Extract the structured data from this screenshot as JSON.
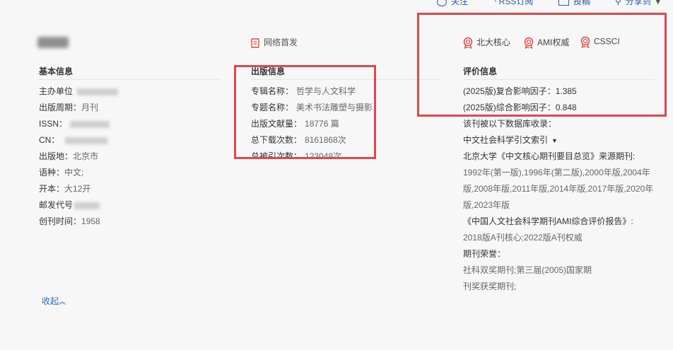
{
  "topbar": {
    "follow": "关注",
    "rss": "RSS订阅",
    "submit": "投稿",
    "share": "分享到"
  },
  "online_first": "网络首发",
  "badges": [
    "北大核心",
    "AMI权威",
    "CSSCI"
  ],
  "basic": {
    "heading": "基本信息",
    "sponsor_label": "主办单位",
    "period_label": "出版周期：",
    "period_value": "月刊",
    "issn_label": "ISSN：",
    "cn_label": "CN：",
    "place_label": "出版地：",
    "place_value": "北京市",
    "lang_label": "语种：",
    "lang_value": "中文;",
    "format_label": "开本：",
    "format_value": "大12开",
    "postal_label": "邮发代号",
    "founded_label": "创刊时间：",
    "founded_value": "1958"
  },
  "pub": {
    "heading": "出版信息",
    "album_label": "专辑名称：",
    "album_value": "哲学与人文科学",
    "topic_label": "专题名称：",
    "topic_value": "美术书法雕塑与摄影",
    "count_label": "出版文献量：",
    "count_value": "18776 篇",
    "downloads_label": "总下载次数：",
    "downloads_value": "8161868次",
    "cites_label": "总被引次数：",
    "cites_value": "123048次"
  },
  "eval": {
    "heading": "评价信息",
    "composite": "(2025版)复合影响因子：1.385",
    "comprehensive": "(2025版)综合影响因子：0.848",
    "indexed_label": "该刊被以下数据库收录：",
    "cssci": "中文社会科学引文索引",
    "pku_title": "北京大学《中文核心期刊要目总览》来源期刊:",
    "pku_line1": "1992年(第一版),1996年(第二版),2000年版,2004年",
    "pku_line2": "版,2008年版,2011年版,2014年版,2017年版,2020年",
    "pku_line3": "版,2023年版",
    "ami_title": "《中国人文社会科学期刊AMI综合评价报告》:",
    "ami_value": "2018版A刊核心;2022版A刊权威",
    "honor_title": "期刊荣誉：",
    "honor_line1": "社科双奖期刊;第三届(2005)国家期",
    "honor_line2": "刊奖获奖期刊;"
  },
  "collapse": "收起"
}
